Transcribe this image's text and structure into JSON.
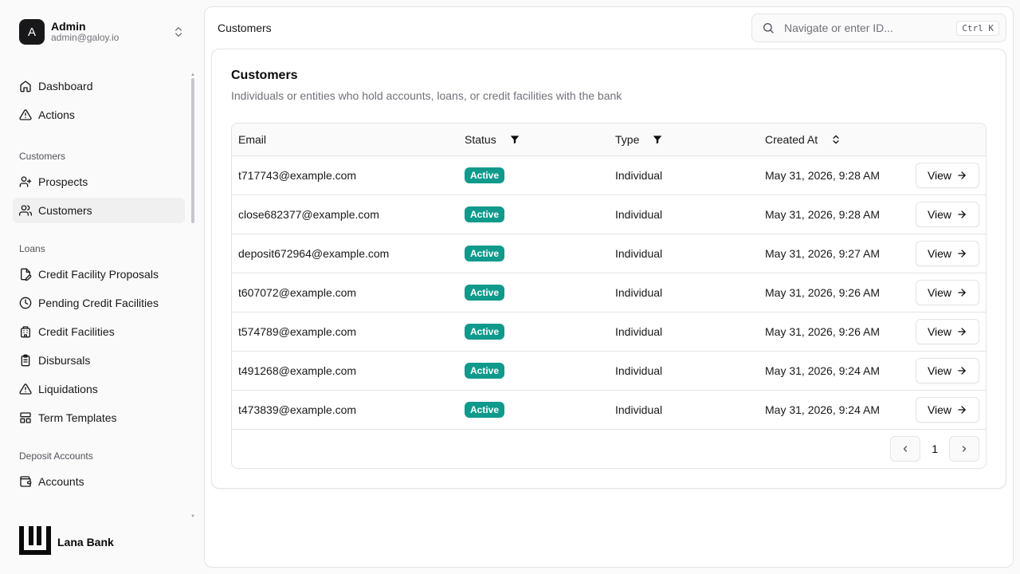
{
  "user": {
    "initial": "A",
    "name": "Admin",
    "email": "admin@galoy.io"
  },
  "nav": {
    "top": [
      {
        "label": "Dashboard",
        "icon": "home-icon"
      },
      {
        "label": "Actions",
        "icon": "alert-triangle-icon"
      }
    ],
    "customers_label": "Customers",
    "customers": [
      {
        "label": "Prospects",
        "icon": "user-plus-icon"
      },
      {
        "label": "Customers",
        "icon": "users-icon",
        "active": true
      }
    ],
    "loans_label": "Loans",
    "loans": [
      {
        "label": "Credit Facility Proposals",
        "icon": "file-pen-icon"
      },
      {
        "label": "Pending Credit Facilities",
        "icon": "clock-icon"
      },
      {
        "label": "Credit Facilities",
        "icon": "building-icon"
      },
      {
        "label": "Disbursals",
        "icon": "clipboard-icon"
      },
      {
        "label": "Liquidations",
        "icon": "alert-triangle-icon"
      },
      {
        "label": "Term Templates",
        "icon": "layout-icon"
      }
    ],
    "deposit_label": "Deposit Accounts",
    "deposit": [
      {
        "label": "Accounts",
        "icon": "wallet-icon"
      }
    ]
  },
  "brand": {
    "name": "Lana Bank"
  },
  "header": {
    "breadcrumb": "Customers",
    "search_placeholder": "Navigate or enter ID...",
    "shortcut": "Ctrl K"
  },
  "card": {
    "title": "Customers",
    "description": "Individuals or entities who hold accounts, loans, or credit facilities with the bank"
  },
  "table": {
    "columns": {
      "email": "Email",
      "status": "Status",
      "type": "Type",
      "created": "Created At"
    },
    "view_label": "View",
    "rows": [
      {
        "email": "t717743@example.com",
        "status": "Active",
        "type": "Individual",
        "created": "May 31, 2026, 9:28 AM"
      },
      {
        "email": "close682377@example.com",
        "status": "Active",
        "type": "Individual",
        "created": "May 31, 2026, 9:28 AM"
      },
      {
        "email": "deposit672964@example.com",
        "status": "Active",
        "type": "Individual",
        "created": "May 31, 2026, 9:27 AM"
      },
      {
        "email": "t607072@example.com",
        "status": "Active",
        "type": "Individual",
        "created": "May 31, 2026, 9:26 AM"
      },
      {
        "email": "t574789@example.com",
        "status": "Active",
        "type": "Individual",
        "created": "May 31, 2026, 9:26 AM"
      },
      {
        "email": "t491268@example.com",
        "status": "Active",
        "type": "Individual",
        "created": "May 31, 2026, 9:24 AM"
      },
      {
        "email": "t473839@example.com",
        "status": "Active",
        "type": "Individual",
        "created": "May 31, 2026, 9:24 AM"
      }
    ]
  },
  "pagination": {
    "current_page": "1"
  },
  "colors": {
    "active_badge": "#0f9a8c",
    "sidebar_active": "#f0f0f1"
  }
}
